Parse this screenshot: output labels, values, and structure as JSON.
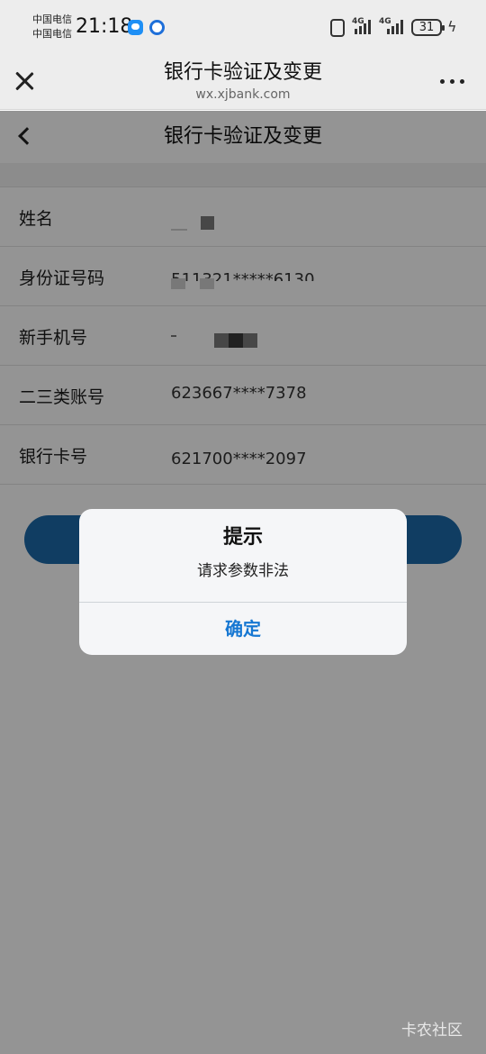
{
  "status_bar": {
    "carrier_1": "中国电信",
    "carrier_2": "中国电信",
    "time": "21:18",
    "network_1": "4G",
    "network_2": "4G",
    "battery": "31"
  },
  "browser": {
    "title": "银行卡验证及变更",
    "url": "wx.xjbank.com"
  },
  "page": {
    "title": "银行卡验证及变更",
    "rows": [
      {
        "label": "姓名",
        "value": ""
      },
      {
        "label": "身份证号码",
        "value": "511321*****6130"
      },
      {
        "label": "新手机号",
        "value": ""
      },
      {
        "label": "二三类账号",
        "value": "623667****7378"
      },
      {
        "label": "银行卡号",
        "value": "621700****2097"
      }
    ]
  },
  "dialog": {
    "title": "提示",
    "message": "请求参数非法",
    "confirm_label": "确定"
  },
  "watermark": "卡农社区",
  "colors": {
    "accent": "#1677d2",
    "button": "#1d6aaa"
  }
}
